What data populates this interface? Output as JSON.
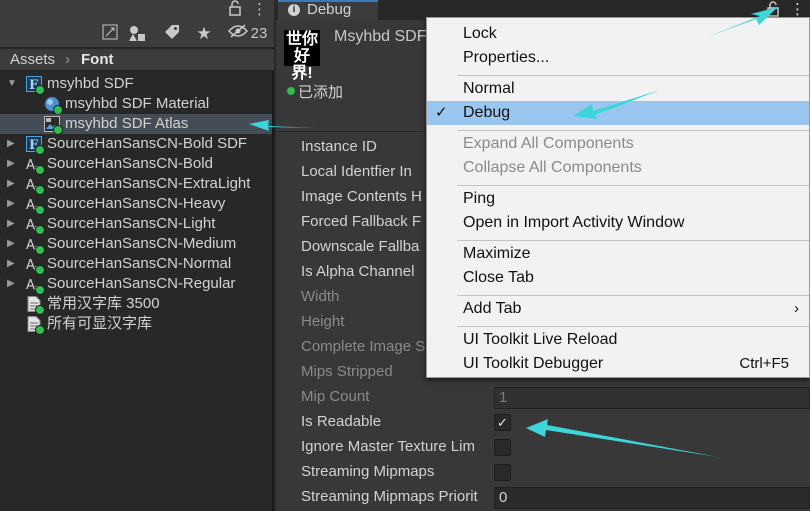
{
  "project": {
    "hidden_count": "23",
    "breadcrumb": {
      "root": "Assets",
      "sep": "›",
      "current": "Font"
    },
    "items": [
      {
        "label": "msyhbd SDF",
        "type": "font-asset",
        "expanded": true
      },
      {
        "label": "msyhbd SDF Material",
        "type": "material"
      },
      {
        "label": "msyhbd SDF Atlas",
        "type": "texture",
        "selected": true
      },
      {
        "label": "SourceHanSansCN-Bold SDF",
        "type": "font-asset"
      },
      {
        "label": "SourceHanSansCN-Bold",
        "type": "font"
      },
      {
        "label": "SourceHanSansCN-ExtraLight",
        "type": "font"
      },
      {
        "label": "SourceHanSansCN-Heavy",
        "type": "font"
      },
      {
        "label": "SourceHanSansCN-Light",
        "type": "font"
      },
      {
        "label": "SourceHanSansCN-Medium",
        "type": "font"
      },
      {
        "label": "SourceHanSansCN-Normal",
        "type": "font"
      },
      {
        "label": "SourceHanSansCN-Regular",
        "type": "font"
      },
      {
        "label": "常用汉字库 3500",
        "type": "text"
      },
      {
        "label": "所有可显汉字库",
        "type": "text"
      }
    ]
  },
  "inspector": {
    "tab_label": "Debug",
    "thumb_text_line1": "世你",
    "thumb_text_line2": "好界!",
    "asset_title": "Msyhbd SDF",
    "added_label": "已添加",
    "properties": [
      {
        "label": "Instance ID",
        "disabled": false
      },
      {
        "label": "Local Identfier In",
        "disabled": false
      },
      {
        "label": "Image Contents H",
        "disabled": false
      },
      {
        "label": "Forced Fallback F",
        "disabled": false
      },
      {
        "label": "Downscale Fallba",
        "disabled": false
      },
      {
        "label": "Is Alpha Channel",
        "disabled": false
      },
      {
        "label": "Width",
        "disabled": true
      },
      {
        "label": "Height",
        "disabled": true
      },
      {
        "label": "Complete Image S",
        "disabled": true
      },
      {
        "label": "Mips Stripped",
        "disabled": true
      },
      {
        "label": "Mip Count",
        "disabled": true,
        "value": "1"
      },
      {
        "label": "Is Readable",
        "disabled": false,
        "checked": true
      },
      {
        "label": "Ignore Master Texture Lim",
        "disabled": false,
        "checked": false
      },
      {
        "label": "Streaming Mipmaps",
        "disabled": false,
        "checked": false
      },
      {
        "label": "Streaming Mipmaps Priorit",
        "disabled": false,
        "value": "0"
      }
    ]
  },
  "menu": {
    "items": [
      {
        "label": "Lock"
      },
      {
        "label": "Properties..."
      },
      {
        "label": "Normal"
      },
      {
        "label": "Debug",
        "checked": true,
        "highlighted": true
      },
      {
        "label": "Expand All Components",
        "disabled": true
      },
      {
        "label": "Collapse All Components",
        "disabled": true
      },
      {
        "label": "Ping"
      },
      {
        "label": "Open in Import Activity Window"
      },
      {
        "label": "Maximize"
      },
      {
        "label": "Close Tab"
      },
      {
        "label": "Add Tab",
        "submenu": true
      },
      {
        "label": "UI Toolkit Live Reload"
      },
      {
        "label": "UI Toolkit Debugger",
        "shortcut": "Ctrl+F5"
      }
    ]
  },
  "colors": {
    "annotation_arrow": "#3cd6da",
    "menu_highlight": "#99c6ef",
    "selection_row": "#444c56",
    "status_added": "#2fbf4f"
  }
}
